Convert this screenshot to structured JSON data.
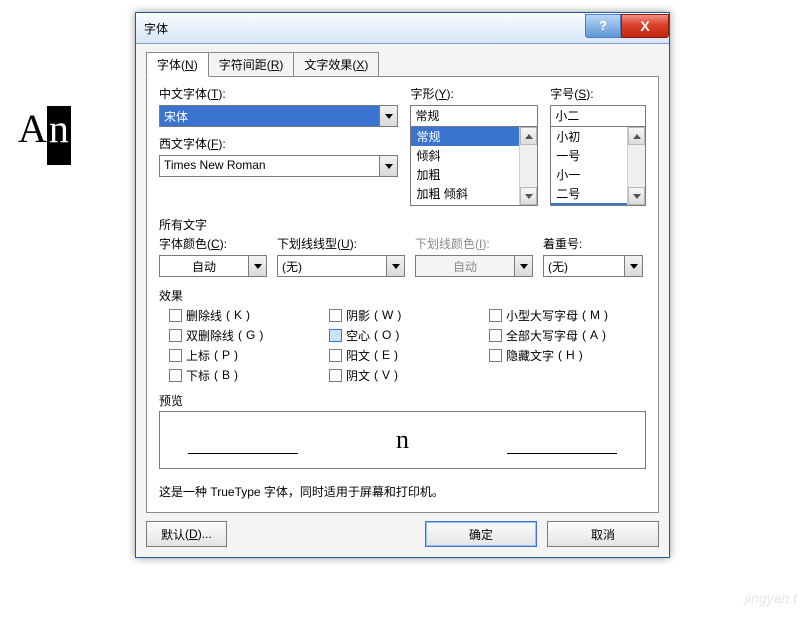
{
  "background_text": {
    "a": "A",
    "n": "n"
  },
  "dialog": {
    "title": "字体",
    "help": "?",
    "close": "X",
    "tabs": [
      {
        "label": "字体",
        "key": "N"
      },
      {
        "label": "字符间距",
        "key": "R"
      },
      {
        "label": "文字效果",
        "key": "X"
      }
    ],
    "cn_font": {
      "label": "中文字体",
      "key": "T",
      "value": "宋体"
    },
    "en_font": {
      "label": "西文字体",
      "key": "F",
      "value": "Times New Roman"
    },
    "style": {
      "label": "字形",
      "key": "Y",
      "value": "常规",
      "options": [
        "常规",
        "倾斜",
        "加粗",
        "加粗 倾斜"
      ],
      "selected_index": 0
    },
    "size": {
      "label": "字号",
      "key": "S",
      "value": "小二",
      "options": [
        "小初",
        "一号",
        "小一",
        "二号",
        "小二"
      ],
      "selected_index": 4
    },
    "all_text_label": "所有文字",
    "font_color": {
      "label": "字体颜色",
      "key": "C",
      "value": "自动"
    },
    "underline": {
      "label": "下划线线型",
      "key": "U",
      "value": "(无)"
    },
    "ul_color": {
      "label": "下划线颜色",
      "key": "I",
      "value": "自动"
    },
    "emphasis": {
      "label": "着重号",
      "key": "",
      "value": "(无)"
    },
    "effects_label": "效果",
    "effects": {
      "col1": [
        {
          "label": "删除线",
          "key": "K",
          "checked": false
        },
        {
          "label": "双删除线",
          "key": "G",
          "checked": false
        },
        {
          "label": "上标",
          "key": "P",
          "checked": false
        },
        {
          "label": "下标",
          "key": "B",
          "checked": false
        }
      ],
      "col2": [
        {
          "label": "阴影",
          "key": "W",
          "checked": false
        },
        {
          "label": "空心",
          "key": "O",
          "checked": true
        },
        {
          "label": "阳文",
          "key": "E",
          "checked": false
        },
        {
          "label": "阴文",
          "key": "V",
          "checked": false
        }
      ],
      "col3": [
        {
          "label": "小型大写字母",
          "key": "M",
          "checked": false
        },
        {
          "label": "全部大写字母",
          "key": "A",
          "checked": false
        },
        {
          "label": "隐藏文字",
          "key": "H",
          "checked": false
        }
      ]
    },
    "preview_label": "预览",
    "preview_char": "n",
    "footnote": "这是一种 TrueType 字体，同时适用于屏幕和打印机。",
    "buttons": {
      "default": {
        "label": "默认",
        "key": "D",
        "suffix": "..."
      },
      "ok": "确定",
      "cancel": "取消"
    }
  },
  "watermark": "jingyan.t"
}
